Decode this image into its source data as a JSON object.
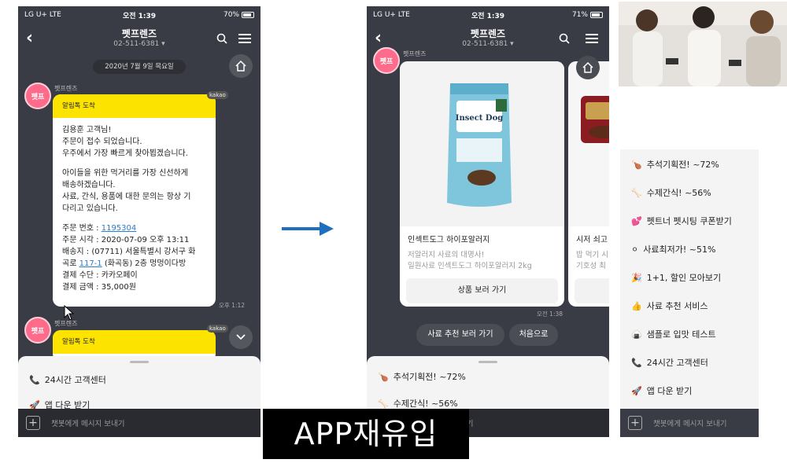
{
  "status": {
    "carrier": "LG U+  LTE",
    "time": "오전 1:39",
    "battery_left": "70%",
    "battery_right": "71%"
  },
  "chat": {
    "title": "펫프렌즈",
    "phone": "02-511-6381 ▾",
    "sender": "펫프렌즈",
    "date": "2020년 7월 9일 목요일",
    "input_placeholder": "챗봇에게 메시지 보내기"
  },
  "avatar_label": "펫프",
  "kakao_badge": "kakao",
  "notification": {
    "header": "알림톡 도착",
    "greeting": "김용훈 고객님!",
    "line1": "주문이 접수 되었습니다.",
    "line2": "우주에서 가장 빠르게 찾아뵙겠습니다.",
    "line3": "아이들을 위한 먹거리를 가장 신선하게",
    "line4": "배송하겠습니다.",
    "line5": "사료, 간식, 용품에 대한 문의는 항상 기",
    "line6": "다리고 있습니다.",
    "order_no_label": "주문 번호 : ",
    "order_no": "1195304",
    "order_time": "주문 시각 : 2020-07-09 오후 13:11",
    "addr1": "배송지 : (07711) 서울특별시 강서구 화",
    "addr2_pre": "곡로 ",
    "addr2_link": "117-1",
    "addr2_post": " (화곡동) 2층 멍멍이다방",
    "payment": "결제 수단 : 카카오페이",
    "amount": "결제 금액 : 35,000원",
    "time": "오후 1:12"
  },
  "second_bubble_header": "알림톡 도착",
  "left_sheet": {
    "item1": "24시간 고객센터",
    "item2": "앱 다운 받기"
  },
  "product_card": {
    "bag_brand": "Insect Dog",
    "name": "인섹트도그 하이포알러지",
    "desc1": "저알러지 사료의 대명사!",
    "desc2": "일원사료 인섹트도그 하이포알러지 2kg",
    "cta": "상품 보러 가기"
  },
  "product_card_2": {
    "name": "시저 쇠고",
    "desc1": "밥 먹기 시",
    "desc2": "기호성 최"
  },
  "card_time": "오전 1:38",
  "quick_buttons": {
    "recommend": "사료 추천 보러 가기",
    "home": "처음으로"
  },
  "right_sheet_preview": {
    "item1": "추석기획전! ~72%",
    "item2": "수제간식! ~56%"
  },
  "menu": [
    {
      "icon": "🍗",
      "label": "추석기획전! ~72%"
    },
    {
      "icon": "🦴",
      "label": "수제간식! ~56%"
    },
    {
      "icon": "💕",
      "label": "펫트너 펫시팅 쿠폰받기"
    },
    {
      "icon": "⚪",
      "label": "사료최저가! ~51%"
    },
    {
      "icon": "🎉",
      "label": "1+1, 할인 모아보기"
    },
    {
      "icon": "👍",
      "label": "사료 추천 서비스"
    },
    {
      "icon": "🍙",
      "label": "샘플로 입맛 테스트"
    },
    {
      "icon": "📞",
      "label": "24시간 고객센터"
    },
    {
      "icon": "🚀",
      "label": "앱 다운 받기"
    }
  ],
  "caption": "APP재유입",
  "colors": {
    "chat_bg": "#3a3c45",
    "kakao_yellow": "#fde300",
    "arrow": "#1f6fc1",
    "link": "#2a7bd1"
  }
}
